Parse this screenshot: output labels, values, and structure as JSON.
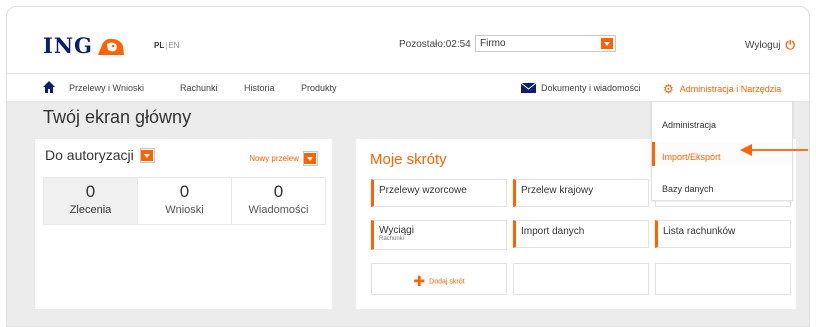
{
  "header": {
    "logo_text": "ING",
    "lang_active": "PL",
    "lang_inactive": "EN",
    "timer_label": "Pozostało:",
    "timer_value": "02:54",
    "company_select": "Firmo",
    "logout_label": "Wyloguj"
  },
  "nav": {
    "items": [
      "Przelewy i Wnioski",
      "Rachunki",
      "Historia",
      "Produkty"
    ],
    "documents": "Dokumenty i wiadomości",
    "admin": "Administracja i Narzędzia"
  },
  "page": {
    "title": "Twój ekran główny"
  },
  "authorization": {
    "title": "Do autoryzacji",
    "new_transfer": "Nowy przelew",
    "counters": [
      {
        "value": "0",
        "label": "Zlecenia"
      },
      {
        "value": "0",
        "label": "Wnioski"
      },
      {
        "value": "0",
        "label": "Wiadomości"
      }
    ]
  },
  "shortcuts": {
    "title": "Moje skróty",
    "items": [
      {
        "label": "Przelewy wzorcowe",
        "sub": ""
      },
      {
        "label": "Przelew krajowy",
        "sub": ""
      },
      {
        "label": "Wyciągi",
        "sub": "Rachunki"
      },
      {
        "label": "Import danych",
        "sub": ""
      },
      {
        "label": "Lista rachunków",
        "sub": ""
      }
    ],
    "add_label": "Dodaj skrót"
  },
  "admin_menu": {
    "items": [
      "Administracja",
      "Import/Eksport",
      "Bazy danych"
    ],
    "highlighted": "Import/Eksport"
  },
  "colors": {
    "accent": "#ff6200",
    "brand": "#0b1e6b",
    "background": "#ececec"
  }
}
